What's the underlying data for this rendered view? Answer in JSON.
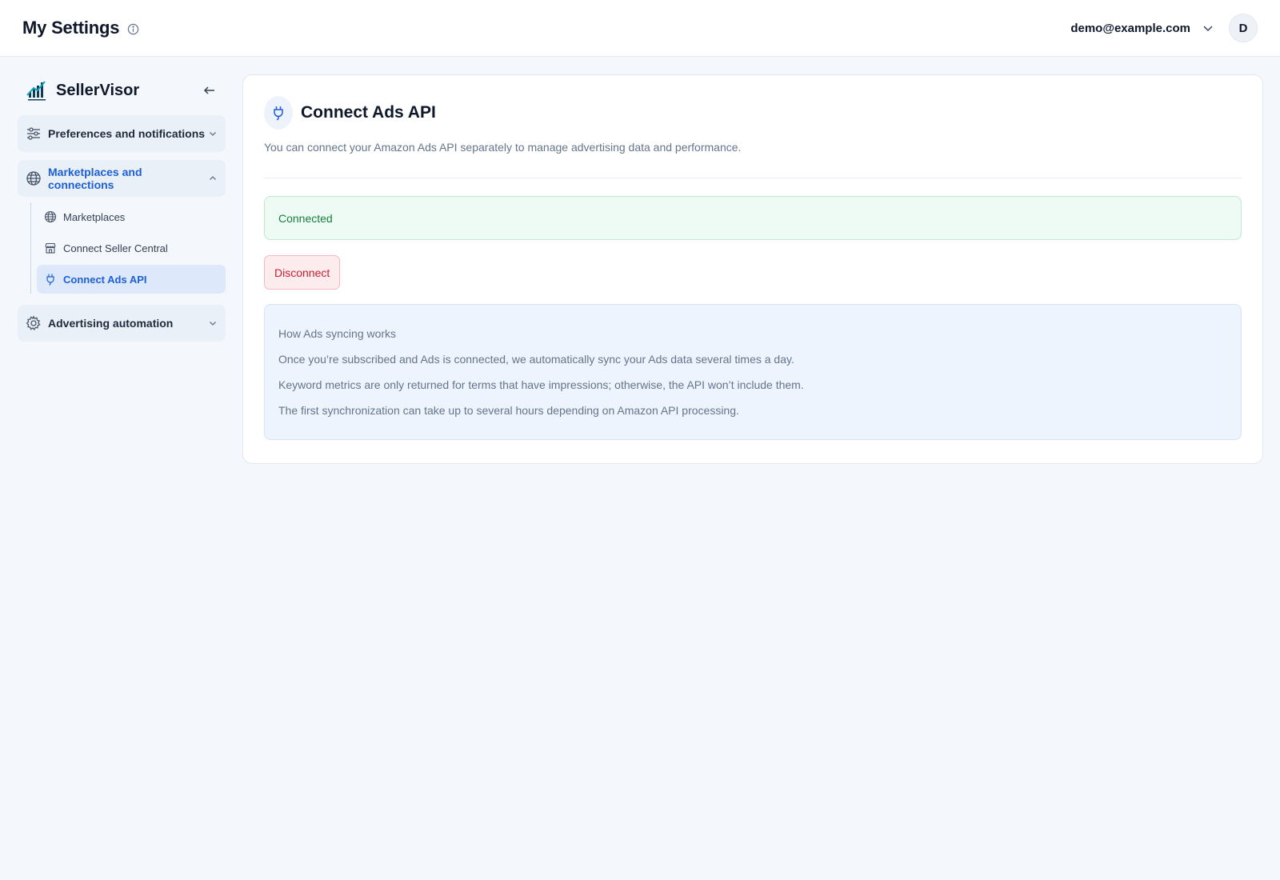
{
  "header": {
    "title": "My Settings",
    "user_email": "demo@example.com",
    "avatar_initial": "D"
  },
  "sidebar": {
    "brand": "SellerVisor",
    "groups": [
      {
        "label": "Preferences and notifications",
        "icon": "sliders-icon",
        "expanded": false
      },
      {
        "label": "Marketplaces and connections",
        "icon": "globe-icon",
        "expanded": true,
        "items": [
          {
            "label": "Marketplaces",
            "icon": "globe-icon"
          },
          {
            "label": "Connect Seller Central",
            "icon": "store-icon"
          },
          {
            "label": "Connect Ads API",
            "icon": "plug-icon",
            "active": true
          }
        ]
      },
      {
        "label": "Advertising automation",
        "icon": "gear-icon",
        "expanded": false
      }
    ]
  },
  "main": {
    "title": "Connect Ads API",
    "description": "You can connect your Amazon Ads API separately to manage advertising data and performance.",
    "status": "Connected",
    "disconnect_label": "Disconnect",
    "info": {
      "heading": "How Ads syncing works",
      "lines": [
        "Once you’re subscribed and Ads is connected, we automatically sync your Ads data several times a day.",
        "Keyword metrics are only returned for terms that have impressions; otherwise, the API won’t include them.",
        "The first synchronization can take up to several hours depending on Amazon API processing."
      ]
    }
  },
  "colors": {
    "accent": "#1d5fd6",
    "success": "#15803d",
    "danger": "#c81e32",
    "background": "#f4f7fb"
  }
}
